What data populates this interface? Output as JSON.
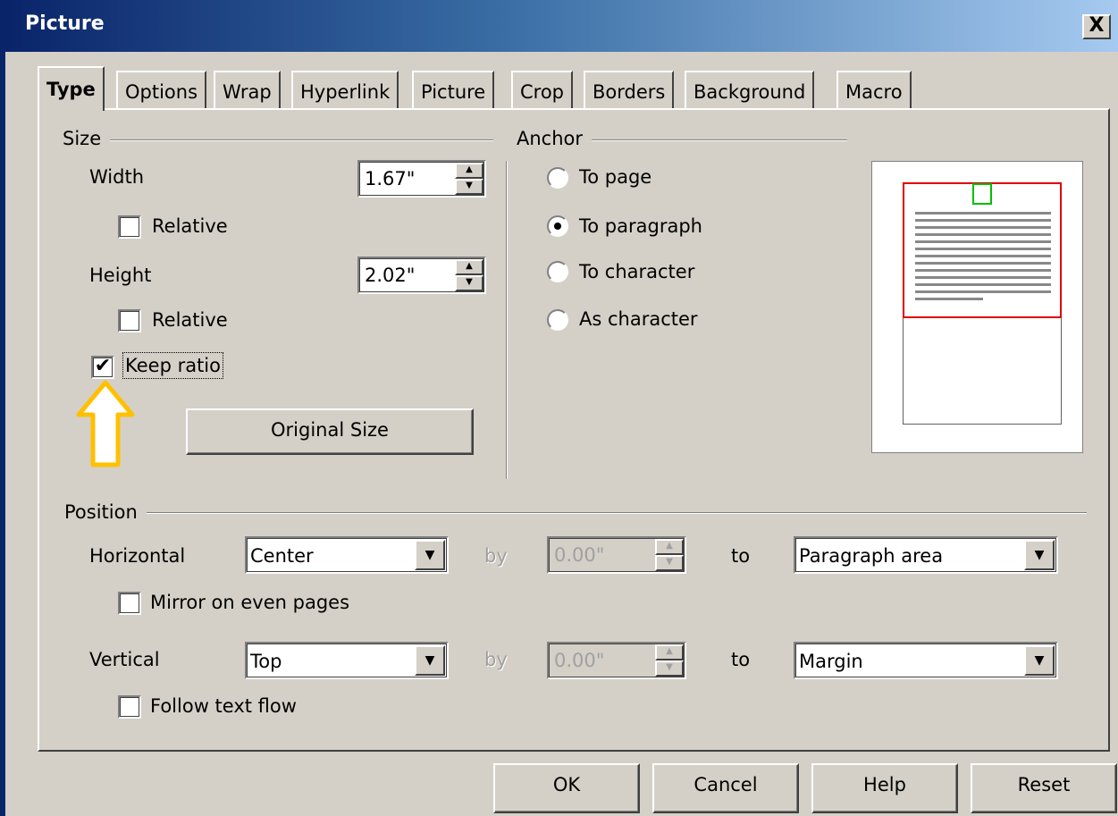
{
  "window": {
    "title": "Picture",
    "close_label": "X"
  },
  "tabs": [
    "Type",
    "Options",
    "Wrap",
    "Hyperlink",
    "Picture",
    "Crop",
    "Borders",
    "Background",
    "Macro"
  ],
  "size": {
    "group_label": "Size",
    "width_label": "Width",
    "width_value": "1.67\"",
    "width_relative": "Relative",
    "height_label": "Height",
    "height_value": "2.02\"",
    "height_relative": "Relative",
    "keep_ratio": "Keep ratio",
    "keep_ratio_checked": true,
    "original_size": "Original Size"
  },
  "anchor": {
    "group_label": "Anchor",
    "options": [
      "To page",
      "To paragraph",
      "To character",
      "As character"
    ],
    "selected": "To paragraph"
  },
  "position": {
    "group_label": "Position",
    "horizontal_label": "Horizontal",
    "horizontal_value": "Center",
    "by_label": "by",
    "horizontal_by_value": "0.00\"",
    "to_label": "to",
    "horizontal_to_value": "Paragraph area",
    "mirror_label": "Mirror on even pages",
    "vertical_label": "Vertical",
    "vertical_value": "Top",
    "vertical_by_value": "0.00\"",
    "vertical_to_value": "Margin",
    "follow_label": "Follow text flow"
  },
  "buttons": {
    "ok": "OK",
    "cancel": "Cancel",
    "help": "Help",
    "reset": "Reset"
  },
  "colors": {
    "titlebar_start": "#0a246a",
    "annotation_arrow": "#ffc000",
    "preview_paragraph": "#e00000",
    "preview_picture": "#00c000"
  }
}
